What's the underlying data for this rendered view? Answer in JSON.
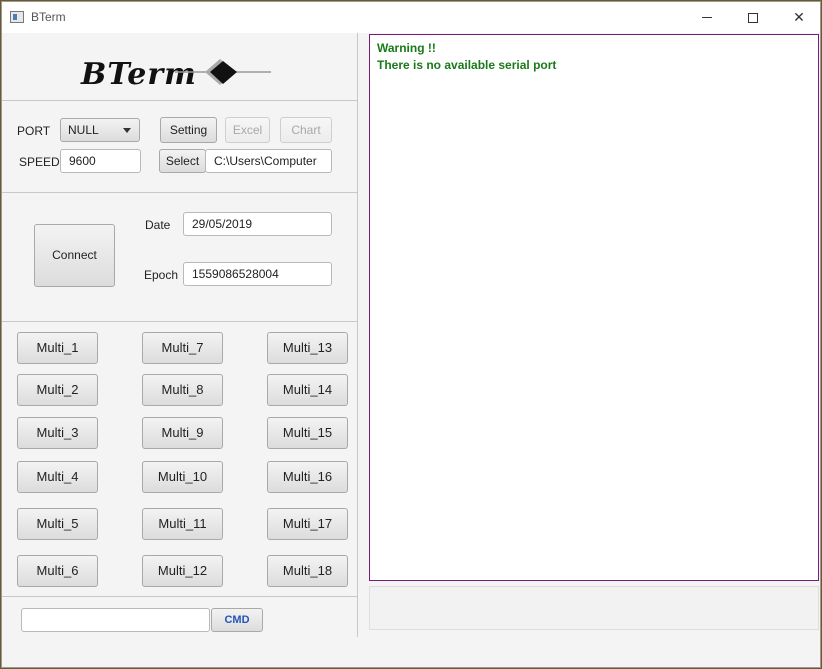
{
  "window": {
    "title": "BTerm"
  },
  "logo": {
    "text": "BTerm"
  },
  "port": {
    "label": "PORT",
    "selected": "NULL"
  },
  "speed": {
    "label": "SPEED",
    "value": "9600"
  },
  "buttons": {
    "setting": "Setting",
    "excel": "Excel",
    "chart": "Chart",
    "select": "Select",
    "connect": "Connect",
    "cmd": "CMD"
  },
  "path": {
    "value": "C:\\Users\\Computer"
  },
  "date": {
    "label": "Date",
    "value": "29/05/2019"
  },
  "epoch": {
    "label": "Epoch",
    "value": "1559086528004"
  },
  "multi": [
    "Multi_1",
    "Multi_2",
    "Multi_3",
    "Multi_4",
    "Multi_5",
    "Multi_6",
    "Multi_7",
    "Multi_8",
    "Multi_9",
    "Multi_10",
    "Multi_11",
    "Multi_12",
    "Multi_13",
    "Multi_14",
    "Multi_15",
    "Multi_16",
    "Multi_17",
    "Multi_18"
  ],
  "console": {
    "lines": [
      "Warning !!",
      "There is no available serial port"
    ]
  },
  "cmd_input": {
    "value": ""
  }
}
